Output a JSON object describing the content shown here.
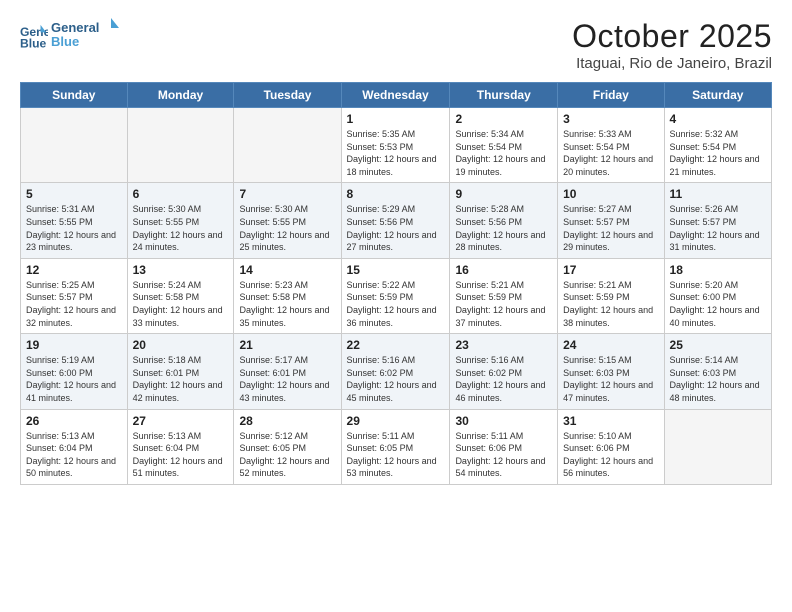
{
  "logo": {
    "line1": "General",
    "line2": "Blue"
  },
  "title": "October 2025",
  "subtitle": "Itaguai, Rio de Janeiro, Brazil",
  "weekdays": [
    "Sunday",
    "Monday",
    "Tuesday",
    "Wednesday",
    "Thursday",
    "Friday",
    "Saturday"
  ],
  "weeks": [
    [
      {
        "day": "",
        "info": ""
      },
      {
        "day": "",
        "info": ""
      },
      {
        "day": "",
        "info": ""
      },
      {
        "day": "1",
        "info": "Sunrise: 5:35 AM\nSunset: 5:53 PM\nDaylight: 12 hours\nand 18 minutes."
      },
      {
        "day": "2",
        "info": "Sunrise: 5:34 AM\nSunset: 5:54 PM\nDaylight: 12 hours\nand 19 minutes."
      },
      {
        "day": "3",
        "info": "Sunrise: 5:33 AM\nSunset: 5:54 PM\nDaylight: 12 hours\nand 20 minutes."
      },
      {
        "day": "4",
        "info": "Sunrise: 5:32 AM\nSunset: 5:54 PM\nDaylight: 12 hours\nand 21 minutes."
      }
    ],
    [
      {
        "day": "5",
        "info": "Sunrise: 5:31 AM\nSunset: 5:55 PM\nDaylight: 12 hours\nand 23 minutes."
      },
      {
        "day": "6",
        "info": "Sunrise: 5:30 AM\nSunset: 5:55 PM\nDaylight: 12 hours\nand 24 minutes."
      },
      {
        "day": "7",
        "info": "Sunrise: 5:30 AM\nSunset: 5:55 PM\nDaylight: 12 hours\nand 25 minutes."
      },
      {
        "day": "8",
        "info": "Sunrise: 5:29 AM\nSunset: 5:56 PM\nDaylight: 12 hours\nand 27 minutes."
      },
      {
        "day": "9",
        "info": "Sunrise: 5:28 AM\nSunset: 5:56 PM\nDaylight: 12 hours\nand 28 minutes."
      },
      {
        "day": "10",
        "info": "Sunrise: 5:27 AM\nSunset: 5:57 PM\nDaylight: 12 hours\nand 29 minutes."
      },
      {
        "day": "11",
        "info": "Sunrise: 5:26 AM\nSunset: 5:57 PM\nDaylight: 12 hours\nand 31 minutes."
      }
    ],
    [
      {
        "day": "12",
        "info": "Sunrise: 5:25 AM\nSunset: 5:57 PM\nDaylight: 12 hours\nand 32 minutes."
      },
      {
        "day": "13",
        "info": "Sunrise: 5:24 AM\nSunset: 5:58 PM\nDaylight: 12 hours\nand 33 minutes."
      },
      {
        "day": "14",
        "info": "Sunrise: 5:23 AM\nSunset: 5:58 PM\nDaylight: 12 hours\nand 35 minutes."
      },
      {
        "day": "15",
        "info": "Sunrise: 5:22 AM\nSunset: 5:59 PM\nDaylight: 12 hours\nand 36 minutes."
      },
      {
        "day": "16",
        "info": "Sunrise: 5:21 AM\nSunset: 5:59 PM\nDaylight: 12 hours\nand 37 minutes."
      },
      {
        "day": "17",
        "info": "Sunrise: 5:21 AM\nSunset: 5:59 PM\nDaylight: 12 hours\nand 38 minutes."
      },
      {
        "day": "18",
        "info": "Sunrise: 5:20 AM\nSunset: 6:00 PM\nDaylight: 12 hours\nand 40 minutes."
      }
    ],
    [
      {
        "day": "19",
        "info": "Sunrise: 5:19 AM\nSunset: 6:00 PM\nDaylight: 12 hours\nand 41 minutes."
      },
      {
        "day": "20",
        "info": "Sunrise: 5:18 AM\nSunset: 6:01 PM\nDaylight: 12 hours\nand 42 minutes."
      },
      {
        "day": "21",
        "info": "Sunrise: 5:17 AM\nSunset: 6:01 PM\nDaylight: 12 hours\nand 43 minutes."
      },
      {
        "day": "22",
        "info": "Sunrise: 5:16 AM\nSunset: 6:02 PM\nDaylight: 12 hours\nand 45 minutes."
      },
      {
        "day": "23",
        "info": "Sunrise: 5:16 AM\nSunset: 6:02 PM\nDaylight: 12 hours\nand 46 minutes."
      },
      {
        "day": "24",
        "info": "Sunrise: 5:15 AM\nSunset: 6:03 PM\nDaylight: 12 hours\nand 47 minutes."
      },
      {
        "day": "25",
        "info": "Sunrise: 5:14 AM\nSunset: 6:03 PM\nDaylight: 12 hours\nand 48 minutes."
      }
    ],
    [
      {
        "day": "26",
        "info": "Sunrise: 5:13 AM\nSunset: 6:04 PM\nDaylight: 12 hours\nand 50 minutes."
      },
      {
        "day": "27",
        "info": "Sunrise: 5:13 AM\nSunset: 6:04 PM\nDaylight: 12 hours\nand 51 minutes."
      },
      {
        "day": "28",
        "info": "Sunrise: 5:12 AM\nSunset: 6:05 PM\nDaylight: 12 hours\nand 52 minutes."
      },
      {
        "day": "29",
        "info": "Sunrise: 5:11 AM\nSunset: 6:05 PM\nDaylight: 12 hours\nand 53 minutes."
      },
      {
        "day": "30",
        "info": "Sunrise: 5:11 AM\nSunset: 6:06 PM\nDaylight: 12 hours\nand 54 minutes."
      },
      {
        "day": "31",
        "info": "Sunrise: 5:10 AM\nSunset: 6:06 PM\nDaylight: 12 hours\nand 56 minutes."
      },
      {
        "day": "",
        "info": ""
      }
    ]
  ]
}
